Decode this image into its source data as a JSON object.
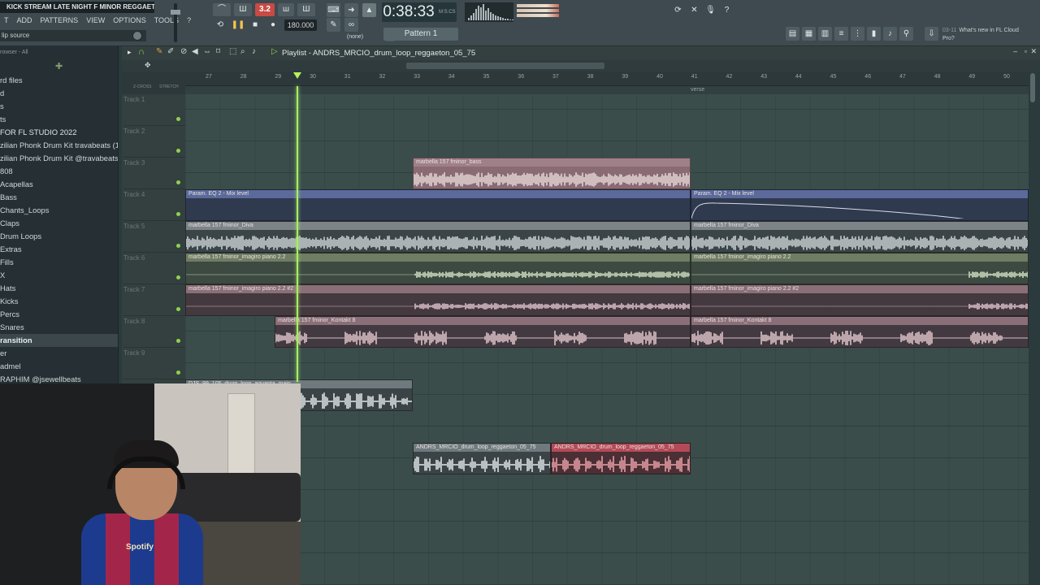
{
  "colors": {
    "playhead": "#a6ef63",
    "grid_bg": "#3a4d4b",
    "pink_clip": "#8a6a73",
    "blue_clip": "#5b6a9a",
    "green_clip": "#6f7d62",
    "red_clip": "#b44a57",
    "track_led": "#8fd14f"
  },
  "topbar": {
    "stream_title": "KICK STREAM LATE NIGHT F MINOR REGGAETO...",
    "menu": [
      "T",
      "ADD",
      "PATTERNS",
      "VIEW",
      "OPTIONS",
      "TOOLS",
      "?"
    ],
    "hint": "lip source",
    "pattern_step": "3.2",
    "tempo": "180.000",
    "time": "0:38:33",
    "time_unit": "M:S:CS",
    "pattern": "Pattern 1",
    "none_label": "(none)",
    "news_date": "03-11",
    "news_text": "What's new in FL Cloud Pro?"
  },
  "browser": {
    "header": "rowser - All",
    "items": [
      {
        "label": "rd files"
      },
      {
        "label": "d"
      },
      {
        "label": "s"
      },
      {
        "label": "ts"
      },
      {
        "label": "FOR FL STUDIO 2022"
      },
      {
        "label": "zilian Phonk Drum Kit travabeats (1)"
      },
      {
        "label": "zilian Phonk Drum Kit @travabeats"
      },
      {
        "label": "808"
      },
      {
        "label": "Acapellas"
      },
      {
        "label": "Bass"
      },
      {
        "label": "Chants_Loops"
      },
      {
        "label": "Claps"
      },
      {
        "label": "Drum Loops"
      },
      {
        "label": "Extras"
      },
      {
        "label": "Fills"
      },
      {
        "label": "X"
      },
      {
        "label": "Hats"
      },
      {
        "label": "Kicks"
      },
      {
        "label": "Percs"
      },
      {
        "label": "Snares"
      },
      {
        "label": "ransition"
      },
      {
        "label": "er"
      },
      {
        "label": "admel"
      },
      {
        "label": "RAPHIM @jsewellbeats"
      }
    ]
  },
  "playlist": {
    "title": "Playlist - ANDRS_MRCIO_drum_loop_reggaeton_05_75",
    "ruler_labels": [
      "27",
      "28",
      "29",
      "30",
      "31",
      "32",
      "33",
      "34",
      "35",
      "36",
      "37",
      "38",
      "39",
      "40",
      "41",
      "42",
      "43",
      "44",
      "45",
      "46",
      "47",
      "48",
      "49",
      "50"
    ],
    "marker": "verse",
    "left_header": [
      "Z-CROSS",
      "STRETCH"
    ],
    "tracks": [
      "Track 1",
      "Track 2",
      "Track 3",
      "Track 4",
      "Track 5",
      "Track 6",
      "Track 7",
      "Track 8",
      "Track 9"
    ],
    "clips": [
      {
        "name": "marbella 157 fminor_bass"
      },
      {
        "name": "Param. EQ 2 - Mix level"
      },
      {
        "name": "Param. EQ 2 - Mix level"
      },
      {
        "name": "marbella 157 fminor_Diva"
      },
      {
        "name": "marbella 157 fminor_Diva"
      },
      {
        "name": "marbella 157 fminor_imagiro piano 2.2"
      },
      {
        "name": "marbella 157 fminor_imagiro piano 2.2"
      },
      {
        "name": "marbella 157 fminor_imagiro piano 2.2 #2"
      },
      {
        "name": "marbella 157 fminor_imagiro piano 2.2 #2"
      },
      {
        "name": "marbella 157 fminor_Kontakt 8"
      },
      {
        "name": "marbella 157 fminor_Kontakt 8"
      },
      {
        "name": "DJS_99_105_drum_loop_aguanta_main"
      },
      {
        "name": "ANDRS_MRCIO_drum_loop_reggaeton_05_75"
      },
      {
        "name": "ANDRS_MRCIO_drum_loop_reggaeton_05_75"
      }
    ]
  },
  "webcam": {
    "jersey_text": "Spotify"
  }
}
